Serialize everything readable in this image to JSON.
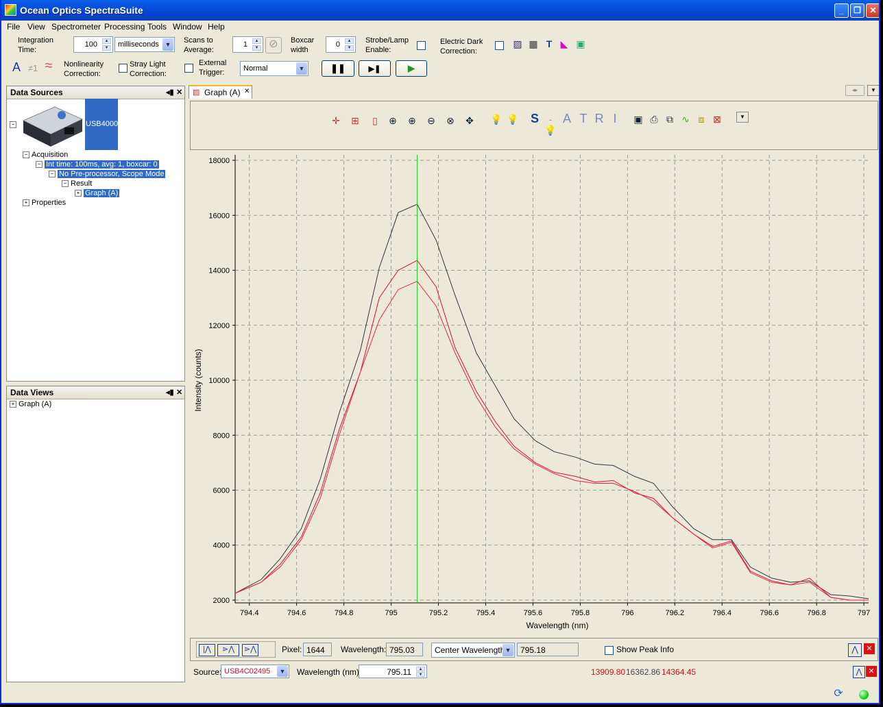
{
  "window": {
    "title": "Ocean Optics SpectraSuite",
    "controls": [
      "minimize-icon",
      "maximize-icon",
      "close-icon"
    ]
  },
  "menu": [
    "File",
    "View",
    "Spectrometer",
    "Processing",
    "Tools",
    "Window",
    "Help"
  ],
  "toolbar": {
    "integration_time_label": "Integration Time:",
    "integration_time_value": "100",
    "integration_unit": "milliseconds",
    "scans_label": "Scans to Average:",
    "scans_value": "1",
    "boxcar_label": "Boxcar width",
    "boxcar_value": "0",
    "strobe_label": "Strobe/Lamp Enable:",
    "dark_label": "Electric Dark Correction:",
    "nonlinearity_label": "Nonlinearity Correction:",
    "stray_label": "Stray Light Correction:",
    "trigger_label": "External Trigger:",
    "trigger_mode": "Normal",
    "a_glyph": "A",
    "ne_glyph": "≠1",
    "wave_glyph": "≈"
  },
  "data_sources": {
    "title": "Data Sources",
    "device": "USB4000",
    "tree": [
      {
        "label": "Acquisition",
        "level": 1
      },
      {
        "label": "Int time: 100ms, avg: 1, boxcar: 0",
        "level": 2
      },
      {
        "label": "No Pre-processor, Scope Mode",
        "level": 3
      },
      {
        "label": "Result",
        "level": 4
      },
      {
        "label": "Graph (A)",
        "level": 5
      },
      {
        "label": "Properties",
        "level": 1
      }
    ]
  },
  "data_views": {
    "title": "Data Views",
    "items": [
      "Graph (A)"
    ]
  },
  "graph_tab": {
    "label": "Graph (A)",
    "letters": [
      "S",
      "A",
      "T",
      "R",
      "I"
    ]
  },
  "chart_data": {
    "type": "line",
    "title": "",
    "xlabel": "Wavelength (nm)",
    "ylabel": "Intensity (counts)",
    "xlim": [
      794.34,
      797.02
    ],
    "ylim": [
      1900,
      18200
    ],
    "xticks": [
      794.4,
      794.6,
      794.8,
      795,
      795.2,
      795.4,
      795.6,
      795.8,
      796,
      796.2,
      796.4,
      796.6,
      796.8,
      797
    ],
    "xtick_labels": [
      "794.4",
      "794.6",
      "794.8",
      "795",
      "795.2",
      "795.4",
      "795.6",
      "795.8",
      "796",
      "796.2",
      "796.4",
      "796.6",
      "796.8",
      "797"
    ],
    "yticks": [
      2000,
      4000,
      6000,
      8000,
      10000,
      12000,
      14000,
      16000,
      18000
    ],
    "ytick_labels": [
      "2000",
      "4000",
      "6000",
      "8000",
      "10000",
      "12000",
      "14000",
      "16000",
      "18000"
    ],
    "grid": true,
    "cursor_x": 795.11,
    "cursor_color": "#22cc22",
    "series": [
      {
        "color": "#333344",
        "x": [
          794.34,
          794.45,
          794.53,
          794.62,
          794.7,
          794.78,
          794.87,
          794.95,
          795.03,
          795.11,
          795.19,
          795.27,
          795.36,
          795.44,
          795.52,
          795.61,
          795.69,
          795.78,
          795.86,
          795.94,
          796.03,
          796.11,
          796.19,
          796.28,
          796.36,
          796.44,
          796.52,
          796.61,
          796.69,
          796.77,
          796.86,
          796.94,
          797.02
        ],
        "y": [
          2250,
          2750,
          3500,
          4600,
          6400,
          8800,
          11100,
          14100,
          16100,
          16400,
          15100,
          13100,
          11000,
          9800,
          8600,
          7800,
          7400,
          7200,
          6950,
          6900,
          6500,
          6250,
          5400,
          4600,
          4200,
          4200,
          3200,
          2800,
          2650,
          2700,
          2200,
          2150,
          2050
        ]
      },
      {
        "color": "#dd1133",
        "x": [
          794.34,
          794.45,
          794.53,
          794.62,
          794.7,
          794.78,
          794.87,
          794.95,
          795.03,
          795.11,
          795.19,
          795.27,
          795.36,
          795.44,
          795.52,
          795.61,
          795.69,
          795.78,
          795.86,
          795.94,
          796.03,
          796.11,
          796.19,
          796.28,
          796.36,
          796.44,
          796.52,
          796.61,
          796.69,
          796.77,
          796.86,
          796.94,
          797.02
        ],
        "y": [
          2250,
          2650,
          3300,
          4300,
          5900,
          8200,
          10300,
          13000,
          14000,
          14360,
          13400,
          11200,
          9600,
          8500,
          7600,
          7000,
          6650,
          6500,
          6300,
          6350,
          5900,
          5700,
          5000,
          4400,
          3950,
          4150,
          3050,
          2700,
          2550,
          2800,
          2100,
          2000,
          2000
        ]
      },
      {
        "color": "#ee2244",
        "x": [
          794.34,
          794.45,
          794.53,
          794.62,
          794.7,
          794.78,
          794.87,
          794.95,
          795.03,
          795.11,
          795.19,
          795.27,
          795.36,
          795.44,
          795.52,
          795.61,
          795.69,
          795.78,
          795.86,
          795.94,
          796.03,
          796.11,
          796.19,
          796.28,
          796.36,
          796.44,
          796.52,
          796.61,
          796.69,
          796.77,
          796.86,
          796.94,
          797.02
        ],
        "y": [
          2250,
          2650,
          3200,
          4200,
          5700,
          8000,
          10300,
          12200,
          13300,
          13600,
          12700,
          11000,
          9400,
          8300,
          7500,
          6950,
          6600,
          6350,
          6250,
          6250,
          5950,
          5600,
          5000,
          4400,
          3900,
          4100,
          3000,
          2650,
          2550,
          2650,
          2100,
          2000,
          2000
        ]
      }
    ]
  },
  "bottom_bar": {
    "pixel_label": "Pixel:",
    "pixel_value": "1644",
    "wavelength_label": "Wavelength:",
    "wavelength_value": "795.03",
    "mode": "Center Wavelength",
    "mode_value": "795.18",
    "show_peak_label": "Show Peak Info",
    "source_label": "Source:",
    "source_value": "USB4C02495",
    "wl_nm_label": "Wavelength (nm):",
    "wl_nm_value": "795.11",
    "readouts": [
      "13909.80",
      "16362.86",
      "14364.45"
    ]
  },
  "colors": {
    "accent": "#316ac5",
    "title_bar": "#0546d3"
  }
}
